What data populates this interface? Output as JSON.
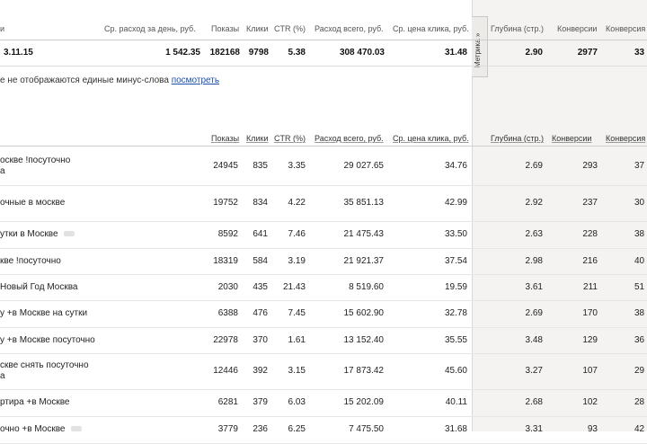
{
  "summary_headers": {
    "h0": "и",
    "spend_per_day": "Ср. расход за день, руб.",
    "impressions": "Показы",
    "clicks": "Клики",
    "ctr": "CTR (%)",
    "spend_total": "Расход всего, руб.",
    "avg_cpc": "Ср. цена клика, руб.",
    "depth": "Глубина (стр.)",
    "conversions": "Конверсии",
    "conv_pct": "Конверсия"
  },
  "metrika_tab": "Метрика »",
  "summary_row": {
    "date": "3.11.15",
    "spend_per_day": "1 542.35",
    "impressions": "182168",
    "clicks": "9798",
    "ctr": "5.38",
    "spend_total": "308 470.03",
    "avg_cpc": "31.48",
    "depth": "2.90",
    "conversions": "2977",
    "conv_pct": "33"
  },
  "note": {
    "text": "е не отображаются единые минус-слова",
    "link": "посмотреть"
  },
  "table_headers": {
    "impressions": "Показы",
    "clicks": "Клики",
    "ctr": "CTR (%)",
    "spend_total": "Расход всего, руб.",
    "avg_cpc": "Ср. цена клика, руб.",
    "depth": "Глубина (стр.)",
    "conversions": "Конверсии",
    "conv_pct": "Конверсия"
  },
  "rows": [
    {
      "kw1": "оскве !посуточно",
      "kw2": "а",
      "impressions": "24945",
      "clicks": "835",
      "ctr": "3.35",
      "spend": "29 027.65",
      "cpc": "34.76",
      "depth": "2.69",
      "conv": "293",
      "convp": "37"
    },
    {
      "kw1": "очные в москве",
      "kw2": "",
      "impressions": "19752",
      "clicks": "834",
      "ctr": "4.22",
      "spend": "35 851.13",
      "cpc": "42.99",
      "depth": "2.92",
      "conv": "237",
      "convp": "30"
    },
    {
      "kw1": "утки в Москве",
      "kw2": "",
      "impressions": "8592",
      "clicks": "641",
      "ctr": "7.46",
      "spend": "21 475.43",
      "cpc": "33.50",
      "depth": "2.63",
      "conv": "228",
      "convp": "38"
    },
    {
      "kw1": "кве !посуточно",
      "kw2": "",
      "impressions": "18319",
      "clicks": "584",
      "ctr": "3.19",
      "spend": "21 921.37",
      "cpc": "37.54",
      "depth": "2.98",
      "conv": "216",
      "convp": "40"
    },
    {
      "kw1": "Новый Год Москва",
      "kw2": "",
      "impressions": "2030",
      "clicks": "435",
      "ctr": "21.43",
      "spend": "8 519.60",
      "cpc": "19.59",
      "depth": "3.61",
      "conv": "211",
      "convp": "51"
    },
    {
      "kw1": "у +в Москве на сутки",
      "kw2": "",
      "impressions": "6388",
      "clicks": "476",
      "ctr": "7.45",
      "spend": "15 602.90",
      "cpc": "32.78",
      "depth": "2.69",
      "conv": "170",
      "convp": "38"
    },
    {
      "kw1": "у +в Москве посуточно",
      "kw2": "",
      "impressions": "22978",
      "clicks": "370",
      "ctr": "1.61",
      "spend": "13 152.40",
      "cpc": "35.55",
      "depth": "3.48",
      "conv": "129",
      "convp": "36"
    },
    {
      "kw1": "скве снять посуточно",
      "kw2": "а",
      "impressions": "12446",
      "clicks": "392",
      "ctr": "3.15",
      "spend": "17 873.42",
      "cpc": "45.60",
      "depth": "3.27",
      "conv": "107",
      "convp": "29"
    },
    {
      "kw1": "ртира +в Москве",
      "kw2": "",
      "impressions": "6281",
      "clicks": "379",
      "ctr": "6.03",
      "spend": "15 202.09",
      "cpc": "40.11",
      "depth": "2.68",
      "conv": "102",
      "convp": "28"
    },
    {
      "kw1": "очно +в Москве",
      "kw2": "",
      "impressions": "3779",
      "clicks": "236",
      "ctr": "6.25",
      "spend": "7 475.50",
      "cpc": "31.68",
      "depth": "3.31",
      "conv": "93",
      "convp": "42"
    }
  ]
}
